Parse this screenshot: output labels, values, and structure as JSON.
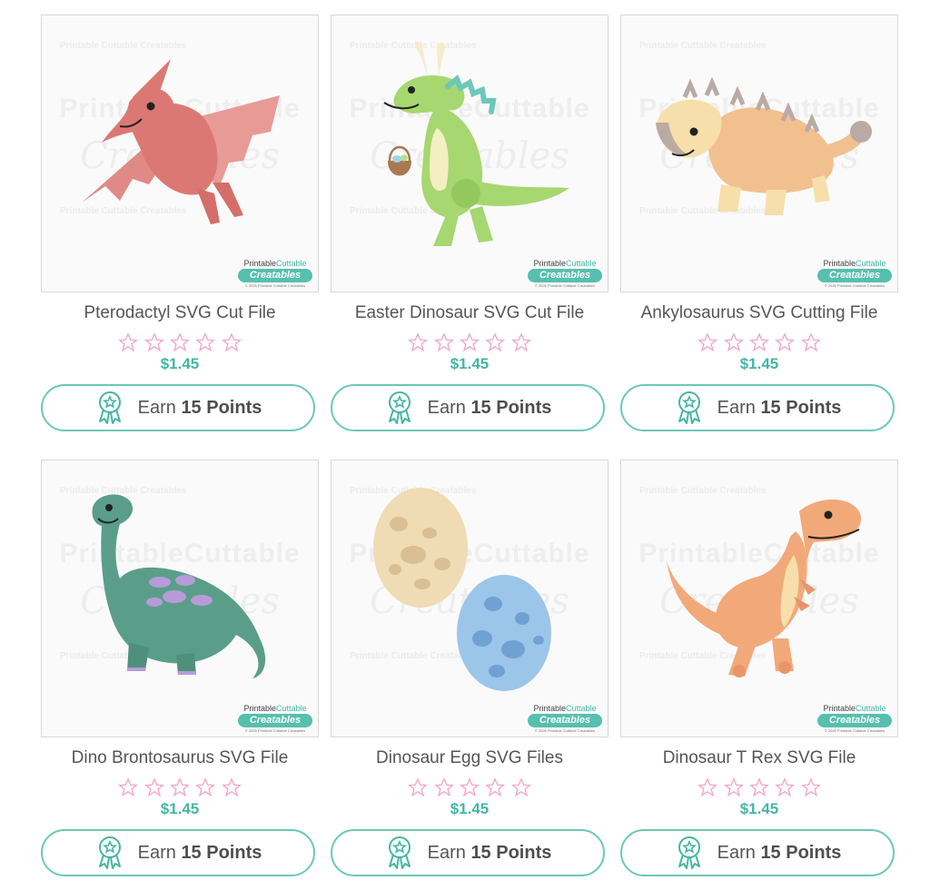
{
  "products": [
    {
      "title": "Pterodactyl SVG Cut File",
      "price": "$1.45",
      "rating": 0,
      "earn_text": "Earn",
      "earn_points": "15 Points",
      "art": "pterodactyl"
    },
    {
      "title": "Easter Dinosaur SVG Cut File",
      "price": "$1.45",
      "rating": 0,
      "earn_text": "Earn",
      "earn_points": "15 Points",
      "art": "easter-dinosaur"
    },
    {
      "title": "Ankylosaurus SVG Cutting File",
      "price": "$1.45",
      "rating": 0,
      "earn_text": "Earn",
      "earn_points": "15 Points",
      "art": "ankylosaurus"
    },
    {
      "title": "Dino Brontosaurus SVG File",
      "price": "$1.45",
      "rating": 0,
      "earn_text": "Earn",
      "earn_points": "15 Points",
      "art": "brontosaurus"
    },
    {
      "title": "Dinosaur Egg SVG Files",
      "price": "$1.45",
      "rating": 0,
      "earn_text": "Earn",
      "earn_points": "15 Points",
      "art": "dinosaur-eggs"
    },
    {
      "title": "Dinosaur T Rex SVG File",
      "price": "$1.45",
      "rating": 0,
      "earn_text": "Earn",
      "earn_points": "15 Points",
      "art": "t-rex"
    }
  ],
  "watermark": {
    "word": "PrintableCuttable",
    "script": "Creatables",
    "small": "Printable Cuttable Creatables"
  },
  "brand": {
    "line1_a": "Printable",
    "line1_b": "Cuttable",
    "name": "Creatables",
    "copyright": "© 2026 Printable Cuttable Creatables"
  },
  "colors": {
    "accent": "#44b6a4",
    "button_border": "#6cc8b9",
    "star_outline": "#f4a6c6"
  },
  "icons": {
    "points": "award-ribbon-icon",
    "rating": "star-outline-icon"
  }
}
